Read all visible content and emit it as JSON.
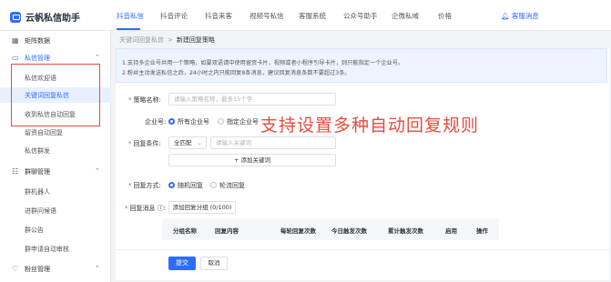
{
  "app": {
    "title": "云帆私信助手"
  },
  "nav": {
    "items": [
      "抖音私信",
      "抖音评论",
      "抖音来客",
      "视频号私信",
      "客服系统",
      "公众号助手",
      "企微私域",
      "价格"
    ],
    "notice": "客服消息"
  },
  "sidebar": {
    "account_data": "矩阵数据",
    "dm_manage": "私信管理",
    "dm_items": [
      "私信欢迎语",
      "关键词回复私信",
      "收到私信自动回复",
      "留资自动回复",
      "私信群发"
    ],
    "group_manage": "群聊管理",
    "group_items": [
      "群机器人",
      "进群问候语",
      "群公告",
      "群申请自动审核"
    ],
    "fans_manage": "粉丝管理"
  },
  "breadcrumb": {
    "parent": "关键词回复私信",
    "sep": ">",
    "current": "新建回复策略"
  },
  "info": {
    "line1": "1.支持多企业号共用一个策略，如要双语请中使用留资卡片，视频或者小程序引导卡片，则只能指定一个企业号。",
    "line2": "2.粉丝主动发送私信之后，24小时之内只能回复8条消息，建议回复消息条数不要超过3条。"
  },
  "form": {
    "strategy_label": "策略名称:",
    "strategy_placeholder": "请输入策略名称，最多15个字",
    "enterprise_label": "企业号:",
    "enterprise_all": "所有企业号",
    "enterprise_specific": "指定企业号",
    "condition_label": "回复条件:",
    "condition_select": "全匹配",
    "keyword_placeholder": "请输入关键词",
    "add_keyword": "+ 添加关键词",
    "mode_label": "回复方式:",
    "mode_random": "随机回复",
    "mode_rotate": "轮流回复",
    "message_label": "回复消息",
    "add_group": "添加回复分组 (0/100)"
  },
  "table": {
    "headers": [
      "分组名称",
      "回复内容",
      "每轮回复次数",
      "今日触发次数",
      "累计触发次数",
      "启用",
      "操作"
    ]
  },
  "footer": {
    "submit": "提交",
    "cancel": "取消"
  },
  "overlay": {
    "text": "支持设置多种自动回复规则"
  },
  "colors": {
    "accent": "#2f6bff",
    "annotation": "#e74c3c"
  }
}
